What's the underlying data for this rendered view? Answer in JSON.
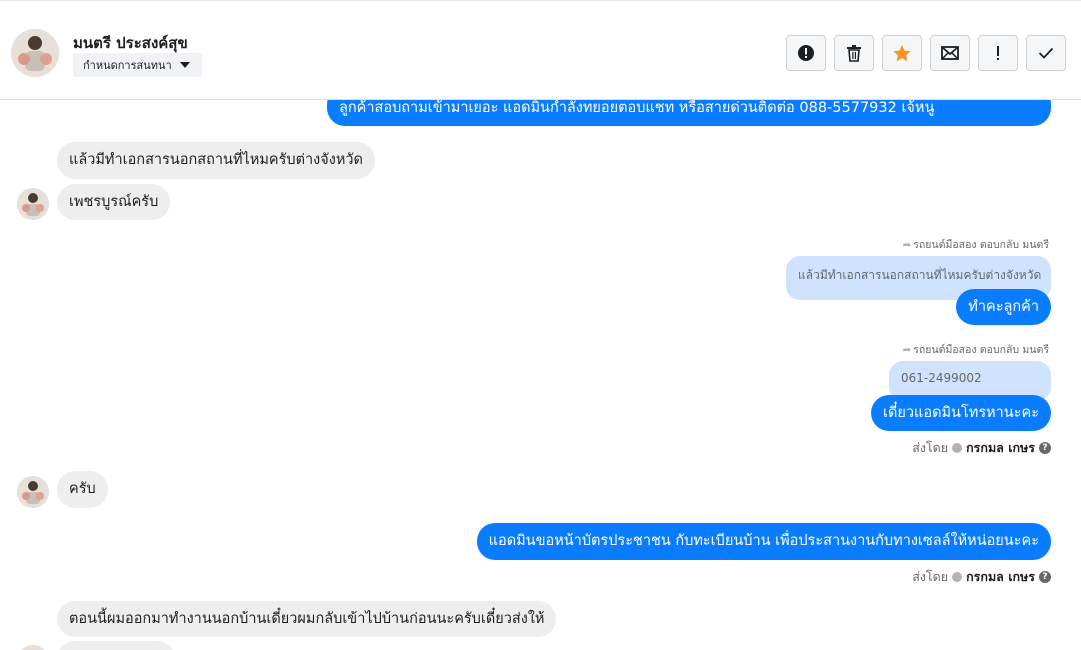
{
  "header": {
    "contact_name": "มนตรี ประสงค์สุข",
    "assign_label": "กำหนดการสนทนา"
  },
  "toolbar": {
    "icons": [
      "report-icon",
      "trash-icon",
      "star-icon",
      "mail-icon",
      "exclamation-icon",
      "check-icon"
    ],
    "accent": "#f7931e"
  },
  "messages": {
    "m1": "ลูกค้าสอบถามเข้ามาเยอะ แอดมินกำลังทยอยตอบแชท หรือสายด่วนติดต่อ 088-5577932 เจ้หนู",
    "m2": "แล้วมีทำเอกสารนอกสถานที่ไหมครับต่างจังหวัด",
    "m3": "เพชรบูรณ์ครับ",
    "m4_reply_label": "รถยนต์มือสอง ตอบกลับ มนตรี",
    "m4_quote": "แล้วมีทำเอกสารนอกสถานที่ไหมครับต่างจังหวัด",
    "m4": "ทำคะลูกค้า",
    "m5_reply_label": "รถยนต์มือสอง ตอบกลับ มนตรี",
    "m5_quote": "061-2499002",
    "m5": "เดี๋ยวแอดมินโทรหานะคะ",
    "m5_sent_prefix": "ส่งโดย",
    "m5_sent_by": "กรกมล เกษร",
    "m6": "ครับ",
    "m7": "แอดมินขอหน้าบัตรประชาชน  กับทะเบียนบ้าน เพื่อประสานงานกับทางเซลล์ให้หน่อยนะคะ",
    "m7_sent_prefix": "ส่งโดย",
    "m7_sent_by": "กรกมล เกษร",
    "m8": "ตอนนี้ผมออกมาทำงานนอกบ้านเดี๋ยวผมกลับเข้าไปบ้านก่อนนะครับเดี๋ยวส่งให้"
  },
  "colors": {
    "outgoing": "#0a7cff",
    "incoming": "#eeeeee",
    "quote": "#cfe3ff"
  }
}
